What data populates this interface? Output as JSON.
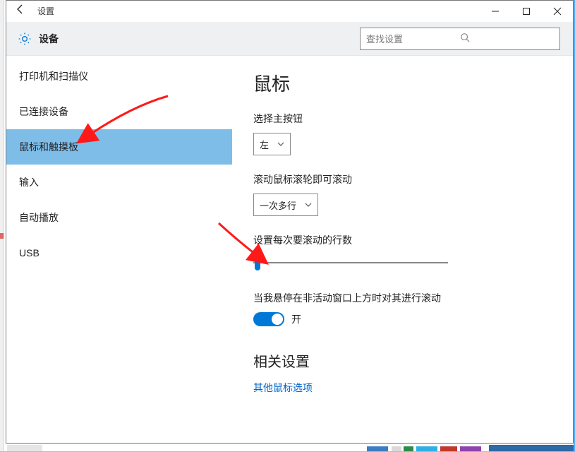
{
  "window": {
    "title": "设置"
  },
  "header": {
    "title": "设备"
  },
  "search": {
    "placeholder": "查找设置"
  },
  "sidebar": {
    "items": [
      {
        "label": "打印机和扫描仪",
        "selected": false
      },
      {
        "label": "已连接设备",
        "selected": false
      },
      {
        "label": "鼠标和触摸板",
        "selected": true
      },
      {
        "label": "输入",
        "selected": false
      },
      {
        "label": "自动播放",
        "selected": false
      },
      {
        "label": "USB",
        "selected": false
      }
    ]
  },
  "main": {
    "section_title": "鼠标",
    "primary_button_label": "选择主按钮",
    "primary_button_value": "左",
    "scroll_mode_label": "滚动鼠标滚轮即可滚动",
    "scroll_mode_value": "一次多行",
    "lines_label": "设置每次要滚动的行数",
    "inactive_label": "当我悬停在非活动窗口上方时对其进行滚动",
    "toggle_state": "开",
    "related_title": "相关设置",
    "related_link": "其他鼠标选项"
  }
}
